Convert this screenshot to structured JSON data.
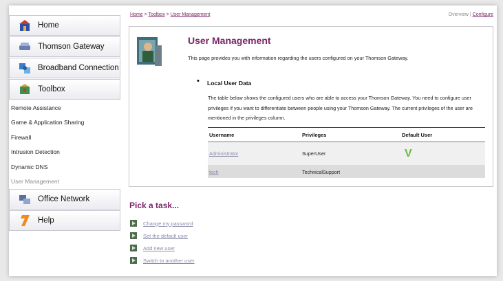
{
  "sidebar": {
    "main_items": [
      {
        "label": "Home",
        "icon": "home-icon"
      },
      {
        "label": "Thomson Gateway",
        "icon": "gateway-icon"
      },
      {
        "label": "Broadband Connection",
        "icon": "broadband-icon"
      },
      {
        "label": "Toolbox",
        "icon": "toolbox-icon"
      }
    ],
    "sub_items": [
      {
        "label": "Remote Assistance"
      },
      {
        "label": "Game & Application Sharing"
      },
      {
        "label": "Firewall"
      },
      {
        "label": "Intrusion Detection"
      },
      {
        "label": "Dynamic DNS"
      },
      {
        "label": "User Management",
        "active": true
      }
    ],
    "bottom_items": [
      {
        "label": "Office Network",
        "icon": "network-icon"
      },
      {
        "label": "Help",
        "icon": "help-icon"
      }
    ]
  },
  "breadcrumb": {
    "items": [
      "Home",
      "Toolbox",
      "User Management"
    ],
    "separator": ">"
  },
  "top_links": {
    "overview": "Overview",
    "divider": "|",
    "configure": "Configure"
  },
  "page": {
    "title": "User Management",
    "intro": "This page provides you with information regarding the users configured on your Thomson Gateway.",
    "section_title": "Local User Data",
    "section_desc": "The table below shows the configured users who are able to access your Thomson Gateway. You need to configure user privileges if you want to differentiate between people using your Thomson Gateway. The current privileges of the user are mentioned in the privileges column."
  },
  "table": {
    "headers": [
      "Username",
      "Privileges",
      "Default User"
    ],
    "rows": [
      {
        "username": "Administrator",
        "privileges": "SuperUser",
        "default": true
      },
      {
        "username": "tech",
        "privileges": "TechnicalSupport",
        "default": false
      }
    ]
  },
  "tasks": {
    "title": "Pick a task...",
    "items": [
      {
        "label": "Change my password"
      },
      {
        "label": "Set the default user"
      },
      {
        "label": "Add new user"
      },
      {
        "label": "Switch to another user"
      }
    ]
  },
  "colors": {
    "accent": "#7a2468",
    "link": "#8a8aaa",
    "check": "#6fb83b"
  }
}
